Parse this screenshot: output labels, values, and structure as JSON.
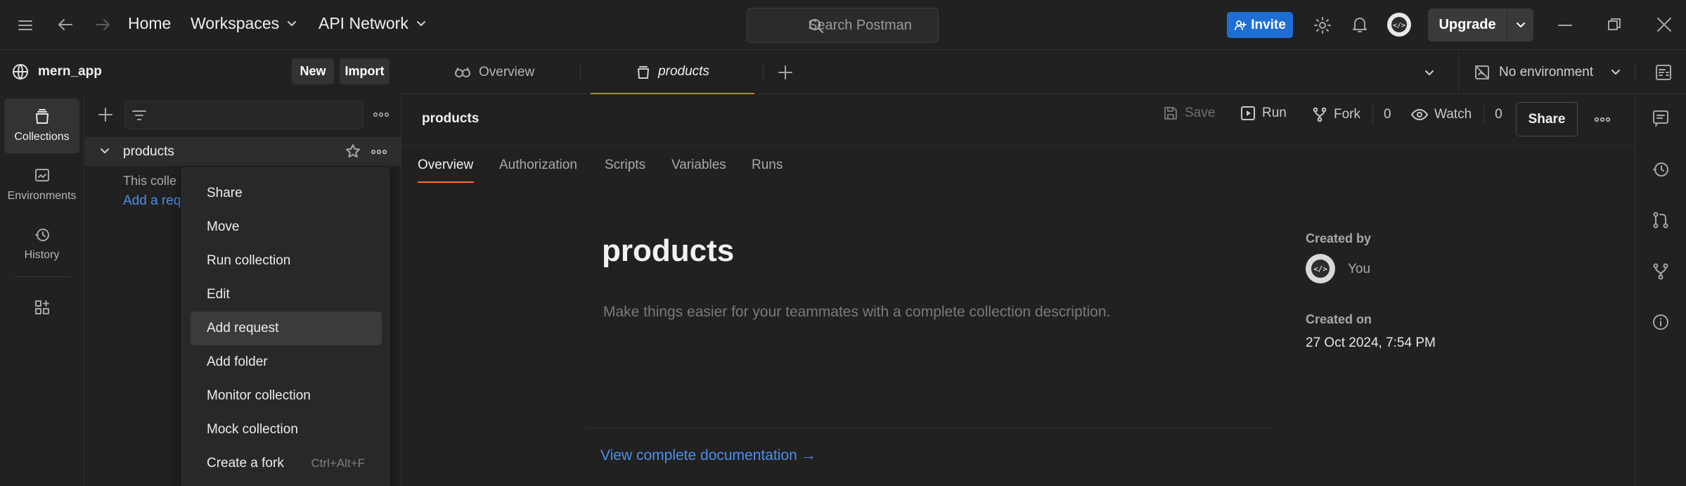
{
  "topbar": {
    "home": "Home",
    "workspaces": "Workspaces",
    "api_network": "API Network",
    "search_placeholder": "Search Postman",
    "invite": "Invite",
    "upgrade": "Upgrade"
  },
  "workspace": {
    "name": "mern_app",
    "new_button": "New",
    "import_button": "Import"
  },
  "rail": {
    "items": [
      {
        "label": "Collections",
        "icon": "collections-icon",
        "active": true
      },
      {
        "label": "Environments",
        "icon": "environments-icon"
      },
      {
        "label": "History",
        "icon": "history-icon"
      }
    ]
  },
  "sidebar": {
    "collection_name": "products",
    "empty_text": "This colle",
    "add_request_link": "Add a req"
  },
  "context_menu": {
    "items": [
      {
        "label": "Share"
      },
      {
        "label": "Move"
      },
      {
        "label": "Run collection"
      },
      {
        "label": "Edit"
      },
      {
        "label": "Add request",
        "hovered": true
      },
      {
        "label": "Add folder"
      },
      {
        "label": "Monitor collection"
      },
      {
        "label": "Mock collection"
      },
      {
        "label": "Create a fork",
        "shortcut": "Ctrl+Alt+F"
      }
    ]
  },
  "tabs": {
    "overview": "Overview",
    "products": "products",
    "environment": "No environment"
  },
  "main": {
    "header_title": "products",
    "actions": {
      "save": "Save",
      "run": "Run",
      "fork": "Fork",
      "fork_count": "0",
      "watch": "Watch",
      "watch_count": "0",
      "share": "Share"
    },
    "subtabs": [
      "Overview",
      "Authorization",
      "Scripts",
      "Variables",
      "Runs"
    ],
    "title": "products",
    "description_placeholder": "Make things easier for your teammates with a complete collection description.",
    "doc_link": "View complete documentation →",
    "created_by_label": "Created by",
    "created_by_value": "You",
    "created_on_label": "Created on",
    "created_on_value": "27 Oct 2024, 7:54 PM"
  },
  "colors": {
    "accent": "#ff6c37",
    "primary_blue": "#1f6ed4",
    "link": "#4c8fea",
    "background": "#212121"
  }
}
